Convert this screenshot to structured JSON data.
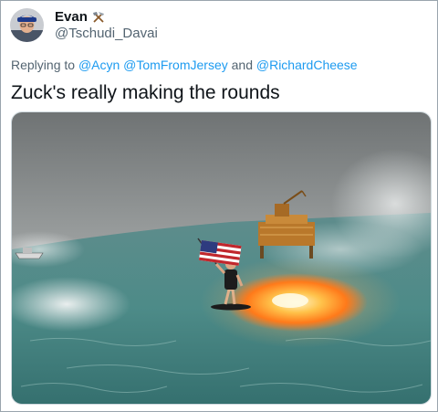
{
  "tweet": {
    "author": {
      "display_name": "Evan",
      "name_emoji": "hammer-and-pick-icon",
      "handle": "@Tschudi_Davai"
    },
    "reply": {
      "prefix": "Replying to",
      "mentions": [
        "@Acyn",
        "@TomFromJersey",
        "@RichardCheese"
      ],
      "joiner": "and"
    },
    "text": "Zuck's really making the rounds",
    "media": {
      "kind": "photo",
      "icon": "ocean-fire-surfer-image"
    }
  },
  "colors": {
    "link": "#1d9bf0",
    "secondary_text": "#536471",
    "primary_text": "#0f1419",
    "fire": "#ff8a1e",
    "sea": "#4d8b88"
  }
}
